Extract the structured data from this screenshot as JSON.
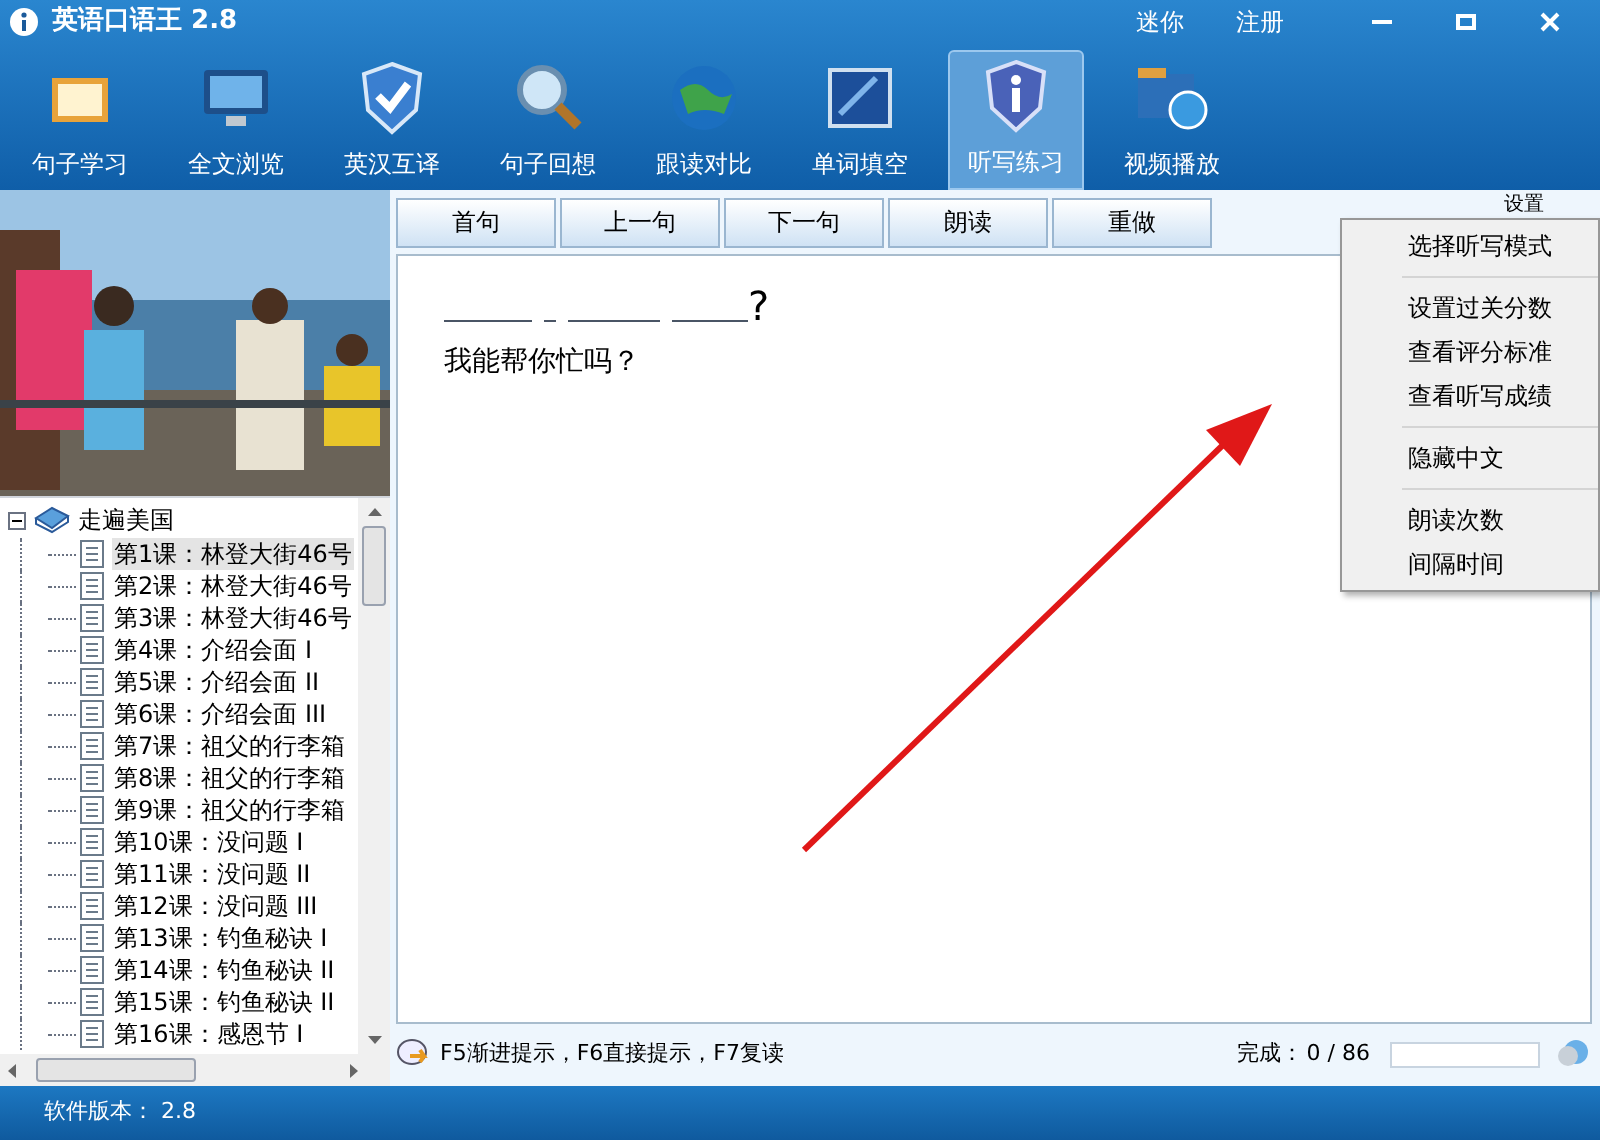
{
  "window": {
    "title": "英语口语王 2.8",
    "links": [
      "迷你",
      "注册"
    ]
  },
  "toolbar": [
    {
      "label": "句子学习",
      "selected": false
    },
    {
      "label": "全文浏览",
      "selected": false
    },
    {
      "label": "英汉互译",
      "selected": false
    },
    {
      "label": "句子回想",
      "selected": false
    },
    {
      "label": "跟读对比",
      "selected": false
    },
    {
      "label": "单词填空",
      "selected": false
    },
    {
      "label": "听写练习",
      "selected": true
    },
    {
      "label": "视频播放",
      "selected": false
    }
  ],
  "tree": {
    "label": "走遍美国",
    "expanded": true,
    "children": [
      {
        "label": "第1课：林登大街46号",
        "selected": true
      },
      {
        "label": "第2课：林登大街46号",
        "selected": false
      },
      {
        "label": "第3课：林登大街46号",
        "selected": false
      },
      {
        "label": "第4课：介绍会面 I",
        "selected": false
      },
      {
        "label": "第5课：介绍会面 II",
        "selected": false
      },
      {
        "label": "第6课：介绍会面 III",
        "selected": false
      },
      {
        "label": "第7课：祖父的行李箱",
        "selected": false
      },
      {
        "label": "第8课：祖父的行李箱",
        "selected": false
      },
      {
        "label": "第9课：祖父的行李箱",
        "selected": false
      },
      {
        "label": "第10课：没问题 I",
        "selected": false
      },
      {
        "label": "第11课：没问题 II",
        "selected": false
      },
      {
        "label": "第12课：没问题 III",
        "selected": false
      },
      {
        "label": "第13课：钓鱼秘诀 I",
        "selected": false
      },
      {
        "label": "第14课：钓鱼秘诀 II",
        "selected": false
      },
      {
        "label": "第15课：钓鱼秘诀 II",
        "selected": false
      },
      {
        "label": "第16课：感恩节 I",
        "selected": false
      }
    ]
  },
  "actions": [
    "首句",
    "上一句",
    "下一句",
    "朗读",
    "重做"
  ],
  "settings_label": "设置",
  "sentence": {
    "punctuation": "?",
    "translation": "我能帮你忙吗？"
  },
  "menu": [
    [
      "选择听写模式"
    ],
    [
      "设置过关分数",
      "查看评分标准",
      "查看听写成绩"
    ],
    [
      "隐藏中文"
    ],
    [
      "朗读次数",
      "间隔时间"
    ]
  ],
  "hint": "F5渐进提示，F6直接提示，F7复读",
  "progress": {
    "label": "完成：",
    "count": "0 / 86",
    "level": 0
  },
  "status_bar": "软件版本： 2.8"
}
